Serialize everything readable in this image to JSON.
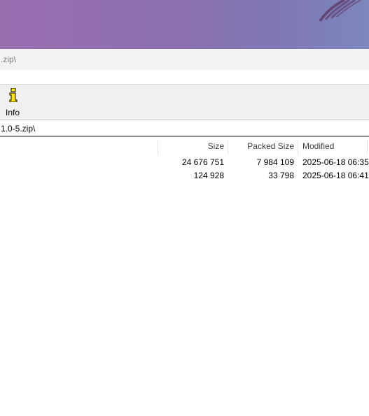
{
  "window": {
    "title_partial": ".zip\\"
  },
  "toolbar": {
    "info_label": "Info"
  },
  "address": {
    "path_partial": "1.0-5.zip\\"
  },
  "columns": {
    "size": "Size",
    "packed_size": "Packed Size",
    "modified": "Modified"
  },
  "rows": [
    {
      "size": "24 676 751",
      "packed_size": "7 984 109",
      "modified": "2025-06-18 06:35"
    },
    {
      "size": "124 928",
      "packed_size": "33 798",
      "modified": "2025-06-18 06:41"
    }
  ],
  "colors": {
    "desktop_gradient_start": "#9a6fb0",
    "desktop_gradient_end": "#7e86bd",
    "toolbar_bg": "#f0f0f0",
    "info_icon_yellow": "#ffe600"
  }
}
